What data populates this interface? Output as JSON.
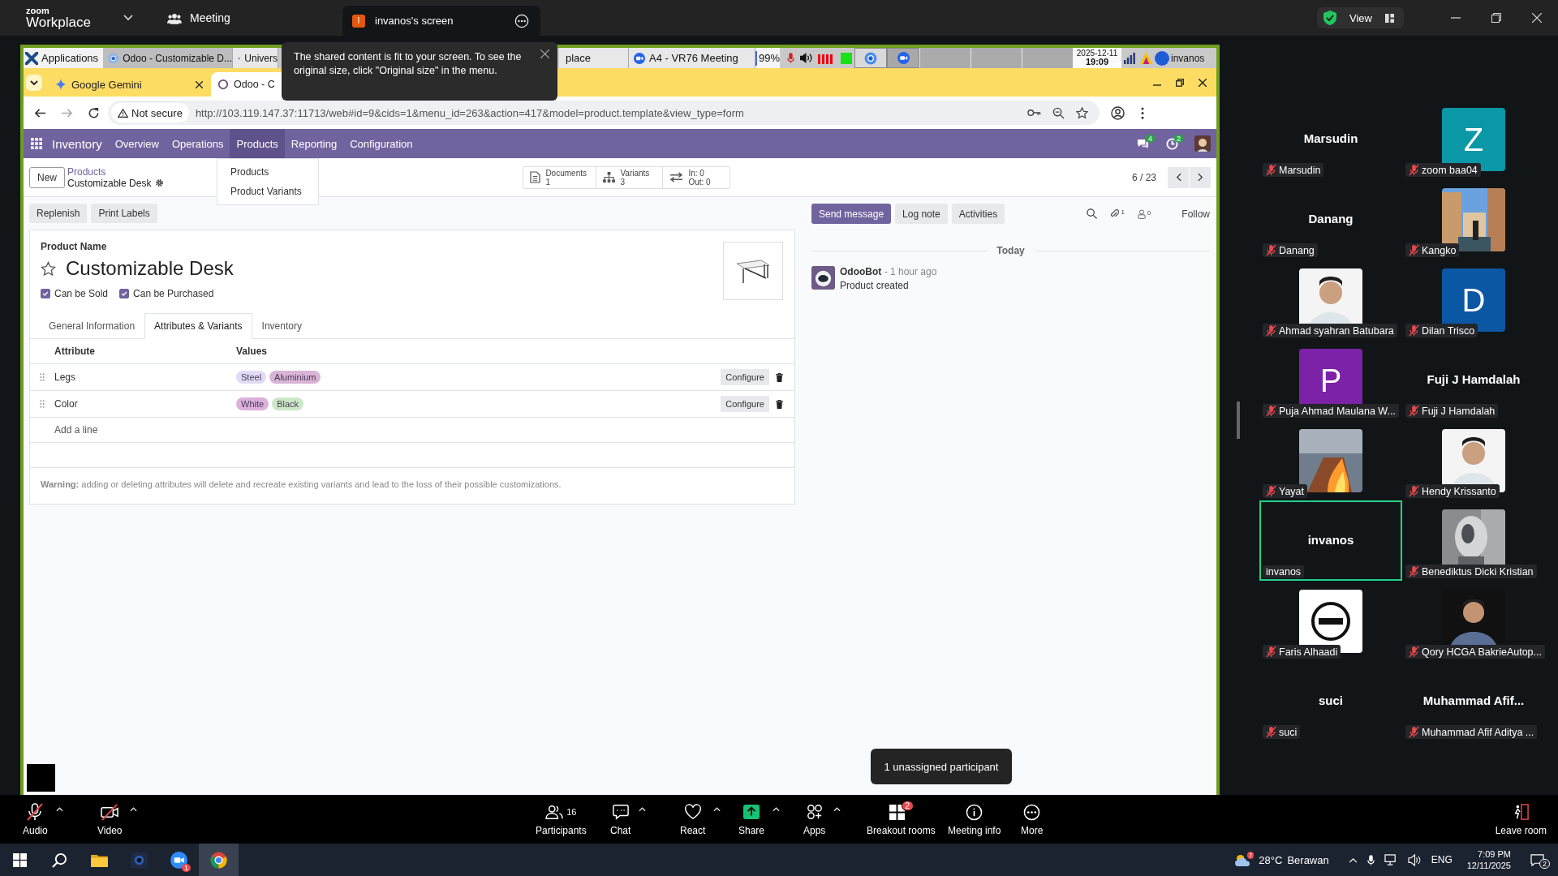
{
  "zoom_bar": {
    "brand_small": "zoom",
    "brand": "Workplace",
    "meeting": "Meeting",
    "share_initial": "I",
    "share_title": "invanos's screen",
    "view": "View"
  },
  "share_notice": "The shared content is fit to your screen. To see the original size, click \"Original size\" in the menu.",
  "remote_taskbar": {
    "launcher": "Applications",
    "windows": [
      {
        "label": "Odoo - Customizable D...",
        "selected": true
      },
      {
        "label": "Univers",
        "selected": false
      },
      {
        "label": "place",
        "selected": false
      },
      {
        "label": "A4 - VR76  Meeting",
        "selected": false
      }
    ],
    "battery": "99%",
    "date": "2025-12-11",
    "time": "19:09",
    "user": "invanos"
  },
  "browser": {
    "tabs": [
      {
        "title": "Google Gemini",
        "selected": false
      },
      {
        "title": "Odoo - C",
        "selected": true
      }
    ],
    "security": "Not secure",
    "url": "http://103.119.147.37:11713/web#id=9&cids=1&menu_id=263&action=417&model=product.template&view_type=form"
  },
  "odoo": {
    "app": "Inventory",
    "menu": [
      {
        "label": "Overview",
        "selected": false
      },
      {
        "label": "Operations",
        "selected": false
      },
      {
        "label": "Products",
        "selected": true
      },
      {
        "label": "Reporting",
        "selected": false
      },
      {
        "label": "Configuration",
        "selected": false
      }
    ],
    "chat_count": "4",
    "activity_count": "2",
    "dropdown": [
      "Products",
      "Product Variants"
    ],
    "new": "New",
    "breadcrumb": {
      "parent": "Products",
      "current": "Customizable Desk"
    },
    "stats": [
      {
        "kind": "documents",
        "label": "Documents",
        "value": "1"
      },
      {
        "kind": "variants",
        "label": "Variants",
        "value": "3"
      },
      {
        "kind": "moves",
        "label": "In: 0",
        "value": "Out: 0"
      }
    ],
    "pager": "6 / 23",
    "actions": [
      "Replenish",
      "Print Labels"
    ],
    "form": {
      "name_label": "Product Name",
      "name": "Customizable Desk",
      "favorite": false,
      "checks": [
        {
          "label": "Can be Sold",
          "checked": true
        },
        {
          "label": "Can be Purchased",
          "checked": true
        }
      ],
      "tabs": [
        {
          "label": "General Information",
          "selected": false
        },
        {
          "label": "Attributes & Variants",
          "selected": true
        },
        {
          "label": "Inventory",
          "selected": false
        }
      ],
      "columns": [
        "Attribute",
        "Values"
      ],
      "rows": [
        {
          "attribute": "Legs",
          "values": [
            {
              "label": "Steel",
              "color": "#e2dbf6"
            },
            {
              "label": "Aluminium",
              "color": "#d9b4d6"
            }
          ],
          "configure": "Configure"
        },
        {
          "attribute": "Color",
          "values": [
            {
              "label": "White",
              "color": "#dcb0dc"
            },
            {
              "label": "Black",
              "color": "#cbe8c6"
            }
          ],
          "configure": "Configure"
        }
      ],
      "add_line": "Add a line",
      "warning": "**Warning:** adding or deleting attributes will delete and recreate existing variants and lead to the loss of their possible customizations."
    },
    "chatter": {
      "buttons": [
        {
          "label": "Send message",
          "selected": true
        },
        {
          "label": "Log note",
          "selected": false
        },
        {
          "label": "Activities",
          "selected": false
        }
      ],
      "attachments": "1",
      "followers": "0",
      "follow": "Follow",
      "divider": "Today",
      "messages": [
        {
          "author": "OdooBot",
          "time": "- 1 hour ago",
          "body": "Product created"
        }
      ]
    }
  },
  "unassigned_tip": "1 unassigned participant",
  "participants": [
    {
      "kind": "name",
      "name": "Marsudin",
      "tag": "Marsudin",
      "muted": true,
      "active": false
    },
    {
      "kind": "avatar",
      "letter": "Z",
      "color": "#0a97a6",
      "tag": "zoom baa04",
      "muted": true,
      "active": false
    },
    {
      "kind": "name",
      "name": "Danang",
      "tag": "Danang",
      "muted": true,
      "active": false
    },
    {
      "kind": "picture",
      "tag": "Kangko",
      "muted": true,
      "active": false
    },
    {
      "kind": "picture",
      "tag": "Ahmad syahran Batubara",
      "muted": true,
      "active": false
    },
    {
      "kind": "avatar",
      "letter": "D",
      "color": "#0b57a4",
      "tag": "Dilan Trisco",
      "muted": true,
      "active": false
    },
    {
      "kind": "avatar",
      "letter": "P",
      "color": "#7b22a8",
      "tag": "Puja Ahmad Maulana W...",
      "muted": true,
      "active": false
    },
    {
      "kind": "name",
      "name": "Fuji J Hamdalah",
      "tag": "Fuji J Hamdalah",
      "muted": true,
      "active": false
    },
    {
      "kind": "picture",
      "tag": "Yayat",
      "muted": true,
      "active": false
    },
    {
      "kind": "picture",
      "tag": "Hendy Krissanto",
      "muted": true,
      "active": false
    },
    {
      "kind": "name",
      "name": "invanos",
      "tag": "invanos",
      "muted": false,
      "active": true
    },
    {
      "kind": "picture",
      "tag": "Benediktus Dicki Kristian",
      "muted": true,
      "active": false
    },
    {
      "kind": "picture",
      "tag": "Faris Alhaadi",
      "muted": true,
      "active": false
    },
    {
      "kind": "picture",
      "tag": "Qory HCGA BakrieAutop...",
      "muted": true,
      "active": false
    },
    {
      "kind": "name",
      "name": "suci",
      "tag": "suci",
      "muted": true,
      "active": false
    },
    {
      "kind": "name",
      "name": "Muhammad  Afif...",
      "tag": "Muhammad Afif Aditya ...",
      "muted": true,
      "active": false
    }
  ],
  "toolbar": [
    {
      "kind": "audio",
      "label": "Audio",
      "off": true,
      "caret": true
    },
    {
      "kind": "video",
      "label": "Video",
      "off": true,
      "caret": true
    },
    {
      "kind": "participants",
      "label": "Participants",
      "count": "16",
      "caret": false
    },
    {
      "kind": "chat",
      "label": "Chat",
      "caret": true
    },
    {
      "kind": "react",
      "label": "React",
      "caret": true
    },
    {
      "kind": "share",
      "label": "Share",
      "caret": true
    },
    {
      "kind": "apps",
      "label": "Apps",
      "caret": true
    },
    {
      "kind": "breakout",
      "label": "Breakout rooms",
      "badge": "2",
      "caret": false
    },
    {
      "kind": "info",
      "label": "Meeting info",
      "caret": false
    },
    {
      "kind": "more",
      "label": "More",
      "caret": false
    },
    {
      "kind": "leave",
      "label": "Leave room",
      "caret": false
    }
  ],
  "taskbar": {
    "apps": [
      {
        "kind": "start",
        "selected": false
      },
      {
        "kind": "search",
        "selected": false
      },
      {
        "kind": "files",
        "selected": false
      },
      {
        "kind": "camera",
        "selected": false
      },
      {
        "kind": "zoom",
        "badge": "1",
        "selected": false
      },
      {
        "kind": "chrome",
        "selected": true
      }
    ],
    "weather_badge": "7",
    "temperature": "28°C",
    "weather": "Berawan",
    "language": "ENG",
    "time": "7:09 PM",
    "date": "12/11/2025",
    "notifications": "2"
  }
}
